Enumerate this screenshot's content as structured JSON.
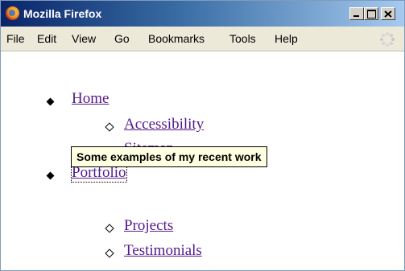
{
  "window": {
    "title": "Mozilla Firefox",
    "app_icon": "firefox-logo"
  },
  "menubar": {
    "items": [
      "File",
      "Edit",
      "View",
      "Go",
      "Bookmarks",
      "Tools",
      "Help"
    ],
    "throbber_icon": "throbber-spinner-icon"
  },
  "nav": {
    "items": [
      {
        "label": "Home",
        "children": [
          "Accessibility",
          "Sitemap"
        ]
      },
      {
        "label": "Portfolio",
        "children": [
          "Projects",
          "Testimonials"
        ]
      }
    ]
  },
  "tooltip": {
    "text": "Some examples of my recent work"
  },
  "colors": {
    "visited_link": "#551a8b",
    "tooltip_bg": "#ffffe1",
    "titlebar_start": "#0a246a",
    "titlebar_end": "#a6caf0",
    "menubar_bg": "#ece9d8"
  }
}
